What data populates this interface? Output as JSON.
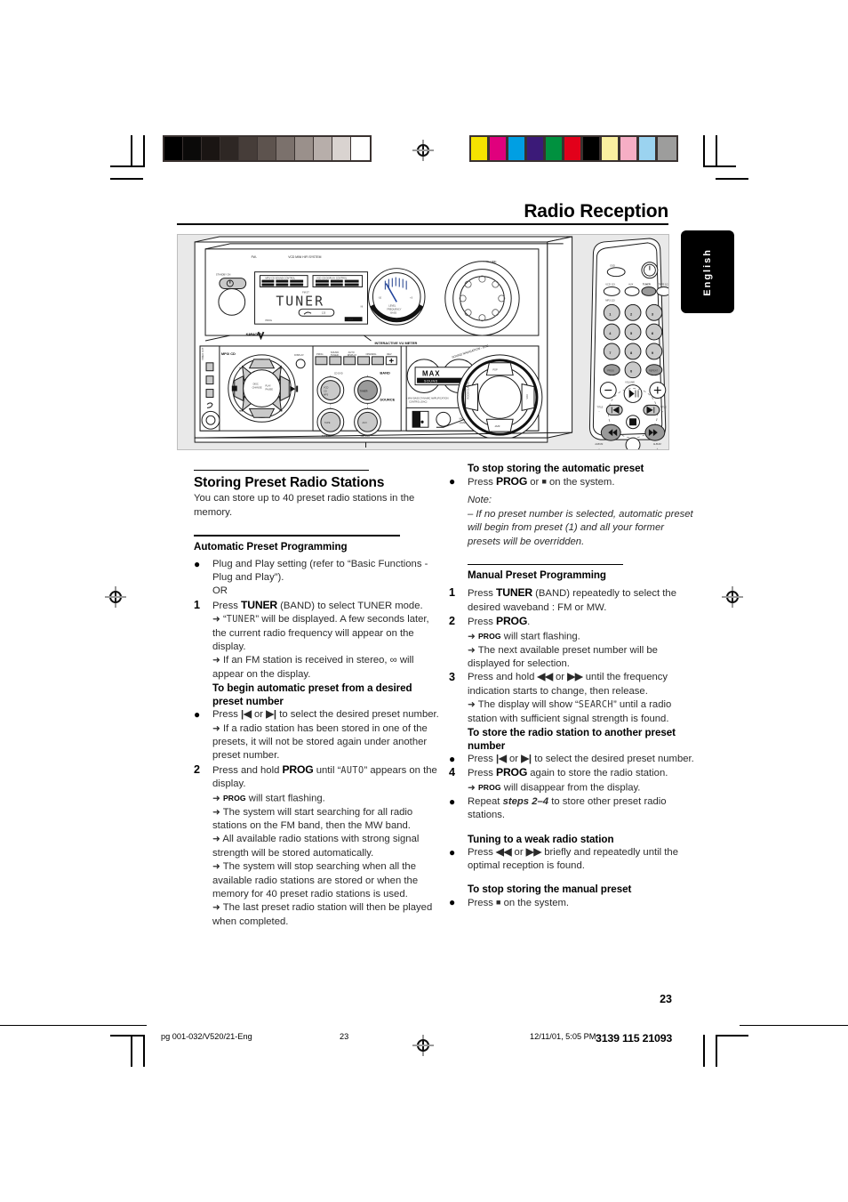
{
  "document": {
    "title": "Radio Reception",
    "language_tab": "English",
    "page_number": "23"
  },
  "footer": {
    "file": "pg 001-032/V520/21-Eng",
    "page": "23",
    "date": "12/11/01, 5:05 PM",
    "code": "3139 115 21093"
  },
  "calibration": {
    "grayscale": [
      "#000000",
      "#0b0a09",
      "#1a1513",
      "#2e2724",
      "#463d39",
      "#5d534e",
      "#7b716c",
      "#9a908b",
      "#b7aeaa",
      "#d9d3d0",
      "#ffffff"
    ],
    "colors": [
      "#f5e300",
      "#e0007d",
      "#009fe3",
      "#3b1a78",
      "#00913f",
      "#e2001a",
      "#000000",
      "#faf0a0",
      "#f6aec5",
      "#9bd3f0",
      "#9d9d9c"
    ]
  },
  "illustration": {
    "system": {
      "brand_line": "FW-",
      "model_line": "VCD MINI HIFI SYSTEM",
      "standby_label": "STANDBY ON",
      "display_text": "TUNER",
      "display_indicators": [
        "FM",
        "ST"
      ],
      "display_prog": "PROG",
      "display_max": "MAX",
      "karaoke_label": "KARAOKE",
      "vu_label": "INTERACTIVE VU METER",
      "vu_sub": "LEVEL/ FREQUENCY/ BASS",
      "volume_label": "VOLUME",
      "deck_label": "MP3/ CD",
      "display_btn": "DISPLAY",
      "top_buttons": [
        "PROG",
        "SOUND TUNER",
        "AUTO DISPLAY",
        "OPENING",
        "REV"
      ],
      "jog_center": [
        "DISC CHANGE",
        "PLAY PAUSE"
      ],
      "source_label": "SOURCE",
      "band_label": "BAND",
      "source_buttons": [
        "VCD CD MP3",
        "TUNER",
        "TAPE",
        "AUX"
      ],
      "source_sublabels": [
        "CD DVD",
        "TAPE 1/2",
        "CD/ DVD"
      ],
      "max_label": "MAX",
      "max_sub": "SOUND",
      "dbb_note": "MAX BASS DYNAMIC AMPLIFICATION CONTROL (DAC)",
      "mic_label": "MIC/ LEVEL",
      "nav_label": "SOUND NAVIGATION - DSC",
      "nav_modes": [
        "POP",
        "ROCK",
        "JAZZ",
        "CLASSIC"
      ]
    },
    "remote": {
      "osd_label": "OSD",
      "power_label": "standby-power",
      "source_row": [
        "VCD 123",
        "AUX",
        "TUNER",
        "TAPE 1/2"
      ],
      "mp3_label": "MP3 123",
      "keypad": [
        "1",
        "2",
        "3",
        "4",
        "5",
        "6",
        "7",
        "8",
        "9",
        "0"
      ],
      "prog_label": "PROG",
      "repeat_label": "REPEAT",
      "volume_label": "VOLUME",
      "volume_minus": "−",
      "volume_plus": "+",
      "title_minus": "TITLE −",
      "title_plus": "TITLE +",
      "album_minus": "ALBUM −",
      "album_plus": "ALBUM +"
    }
  },
  "left_column": {
    "heading": "Storing Preset Radio Stations",
    "intro": "You can store up to 40 preset radio stations in the memory.",
    "sub1": "Automatic Preset Programming",
    "items": [
      {
        "marker": "●",
        "text": "Plug and Play setting (refer to “Basic Functions - Plug and Play”)."
      },
      {
        "marker": "",
        "text": "OR"
      }
    ],
    "step1_marker": "1",
    "step1_lead": "Press ",
    "step1_kw": "TUNER",
    "step1_rest": " (BAND) to select TUNER mode.",
    "step1_a_pre": "“",
    "step1_a_lcd": "TUNER",
    "step1_a_post": "” will be displayed.  A few seconds later, the current radio frequency will appear on the display.",
    "step1_b": "If an FM station is received in stereo, ∞ will appear on the display.",
    "sub2": "To begin automatic preset from a desired preset number",
    "bullet_a_pre": "Press ",
    "bullet_a_post": " to select the desired preset number.",
    "bullet_a_note": "If a radio station has been stored in one of the presets, it will not be stored again under another preset number.",
    "step2_marker": "2",
    "step2_lead": "Press and hold ",
    "step2_kw": "PROG",
    "step2_mid": " until “",
    "step2_lcd": "AUTO",
    "step2_post": "” appears on the display.",
    "step2_notes": [
      {
        "kw": "PROG",
        "text": " will start flashing."
      },
      {
        "kw": "",
        "text": "The system will start searching for all radio stations on the FM band, then the MW band."
      },
      {
        "kw": "",
        "text": "All available radio stations with strong signal strength will be stored automatically."
      },
      {
        "kw": "",
        "text": "The system will stop searching when all the available radio stations are stored or when the memory for 40 preset radio stations is used."
      },
      {
        "kw": "",
        "text": "The last preset radio station will then be played when completed."
      }
    ]
  },
  "right_column": {
    "sub1": "To stop storing the automatic preset",
    "bullet1_pre": "Press ",
    "bullet1_kw": "PROG",
    "bullet1_mid": " or ",
    "bullet1_post": " on the system.",
    "note_label": "Note:",
    "note_text": "–  If no preset number is selected, automatic preset will begin from preset (1) and all your former presets will be overridden.",
    "sub2": "Manual Preset Programming",
    "step1_marker": "1",
    "step1_lead": "Press ",
    "step1_kw": "TUNER",
    "step1_rest": " (BAND) repeatedly to select the desired waveband : FM or MW.",
    "step2_marker": "2",
    "step2_lead": "Press ",
    "step2_kw": "PROG",
    "step2_rest": ".",
    "step2_note1_kw": "PROG",
    "step2_note1": " will start flashing.",
    "step2_note2": "The next available preset number will be displayed for selection.",
    "step3_marker": "3",
    "step3_pre": "Press and hold  ",
    "step3_mid": " or ",
    "step3_post": " until the frequency indication starts to change, then release.",
    "step3_note_pre": "The display will show “",
    "step3_note_lcd": "SEARCH",
    "step3_note_post": "” until a radio station with sufficient signal strength is found.",
    "sub3": "To store the radio station to another preset number",
    "bullet2_pre": "Press ",
    "bullet2_post": " to select the desired preset number.",
    "step4_marker": "4",
    "step4_lead": "Press ",
    "step4_kw": "PROG",
    "step4_rest": " again to store the radio station.",
    "step4_note_kw": "PROG",
    "step4_note": " will disappear from the display.",
    "bullet3_pre": "Repeat ",
    "bullet3_em": "steps 2–4",
    "bullet3_post": " to store other preset radio stations.",
    "sub4": "Tuning to a weak radio station",
    "bullet4_pre": "Press ",
    "bullet4_mid": " or ",
    "bullet4_post": " briefly and repeatedly until the optimal reception is found.",
    "sub5": "To stop storing the manual preset",
    "bullet5_pre": "Press ",
    "bullet5_post": " on the system."
  }
}
